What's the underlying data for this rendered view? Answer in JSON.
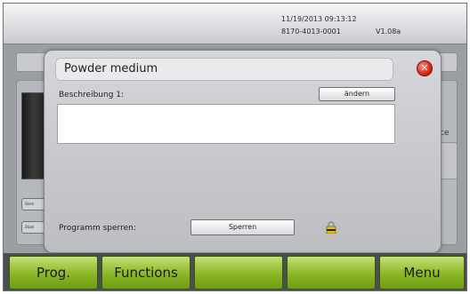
{
  "header": {
    "datetime": "11/19/2013 09:13:12",
    "device_id": "8170-4013-0001",
    "version": "V1.08a"
  },
  "background": {
    "right_label": "ce",
    "side_buttons": [
      "Stam",
      "Stam"
    ]
  },
  "dialog": {
    "title": "Powder medium",
    "description_label": "Beschreibung 1:",
    "change_button": "ändern",
    "description_value": "",
    "lock_label": "Programm sperren:",
    "lock_button": "Sperren",
    "close_icon": "close-icon",
    "lock_icon": "padlock-icon"
  },
  "menu": {
    "buttons": [
      "Prog.",
      "Functions",
      "",
      "",
      "Menu"
    ]
  },
  "colors": {
    "menu_button": "#8fbb2a",
    "close_button": "#d42a1a",
    "dialog_bg": "#c5c7cb"
  }
}
